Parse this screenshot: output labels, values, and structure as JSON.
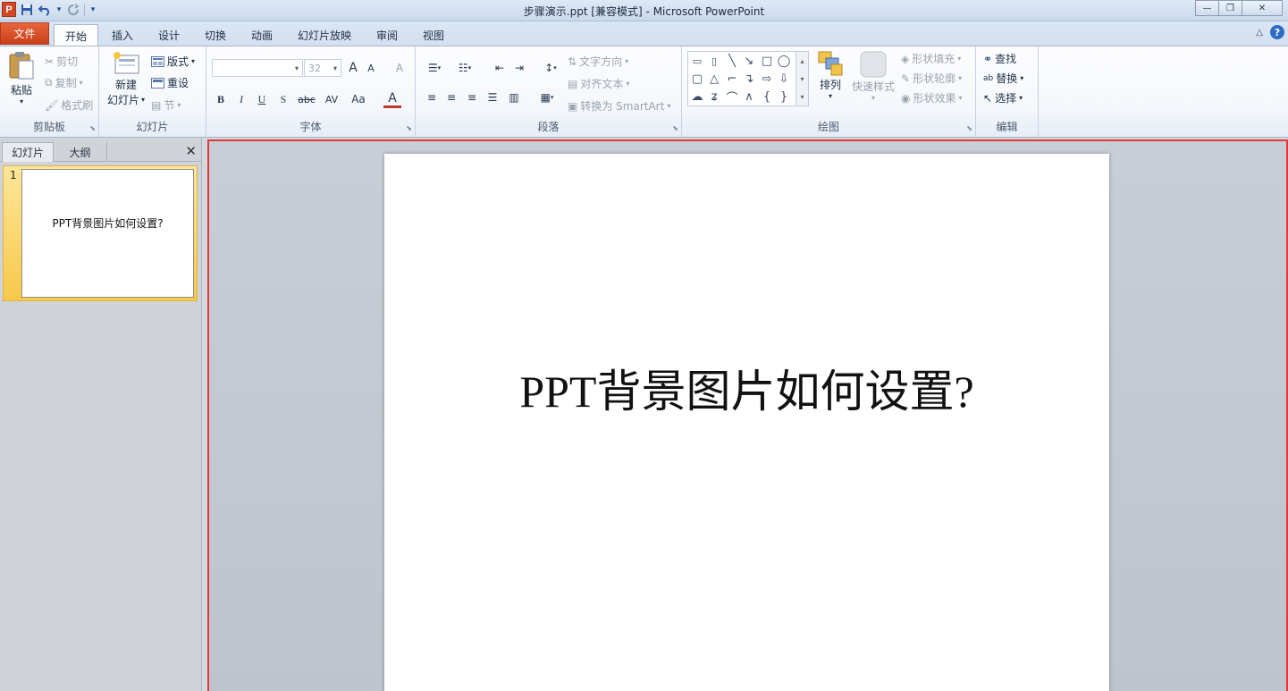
{
  "window": {
    "title": "步骤演示.ppt [兼容模式] - Microsoft PowerPoint",
    "app_logo": "P",
    "controls": {
      "minimize": "—",
      "restore": "❐",
      "close": "✕"
    }
  },
  "quick_access": {
    "save": "💾",
    "undo": "↶",
    "undo_arrow": "▾",
    "redo": "↻",
    "customize": "▾"
  },
  "tabs": {
    "file": "文件",
    "items": [
      "开始",
      "插入",
      "设计",
      "切换",
      "动画",
      "幻灯片放映",
      "审阅",
      "视图"
    ],
    "active": "开始",
    "help": "?",
    "minimize_ribbon": "△"
  },
  "ribbon": {
    "clipboard": {
      "label": "剪贴板",
      "paste": "粘贴",
      "cut": "剪切",
      "copy": "复制",
      "format_painter": "格式刷"
    },
    "slides": {
      "label": "幻灯片",
      "new_slide_1": "新建",
      "new_slide_2": "幻灯片",
      "layout": "版式",
      "reset": "重设",
      "section": "节"
    },
    "font": {
      "label": "字体",
      "font_name": "",
      "font_size": "32",
      "grow": "A",
      "shrink": "A",
      "clear": "A",
      "bold": "B",
      "italic": "I",
      "underline": "U",
      "shadow": "S",
      "strike": "abc",
      "spacing": "AV",
      "case": "Aa",
      "color": "A"
    },
    "paragraph": {
      "label": "段落",
      "text_direction": "文字方向",
      "align_text": "对齐文本",
      "convert_smartart": "转换为 SmartArt"
    },
    "drawing": {
      "label": "绘图",
      "arrange": "排列",
      "quick_styles": "快速样式",
      "shape_fill": "形状填充",
      "shape_outline": "形状轮廓",
      "shape_effects": "形状效果"
    },
    "editing": {
      "label": "编辑",
      "find": "查找",
      "replace": "替换",
      "select": "选择"
    }
  },
  "left_panel": {
    "tabs": [
      "幻灯片",
      "大纲"
    ],
    "active_tab": "幻灯片",
    "close": "✕",
    "slides": [
      {
        "number": "1",
        "title": "PPT背景图片如何设置?"
      }
    ]
  },
  "slide": {
    "title": "PPT背景图片如何设置?"
  }
}
